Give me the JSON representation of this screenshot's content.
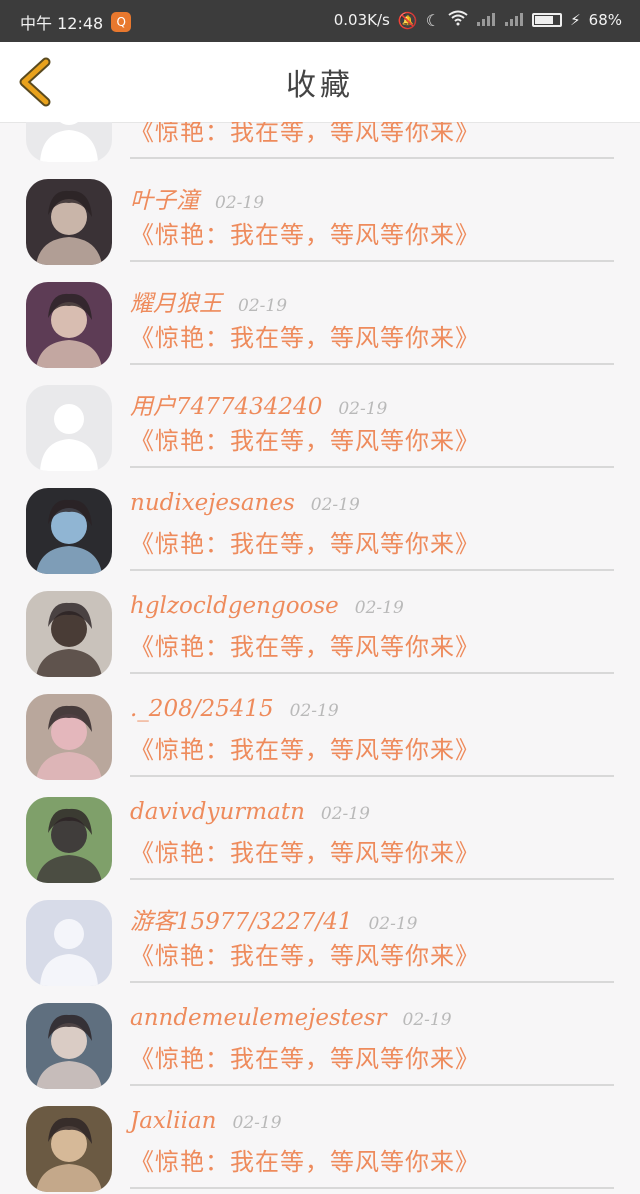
{
  "status_bar": {
    "time": "中午 12:48",
    "app_badge": "Q",
    "net_speed": "0.03K/s",
    "battery_percent": "68%",
    "battery_level": 0.68
  },
  "header": {
    "title": "收藏",
    "back_icon": "chevron-left-icon",
    "accent": "#e9a21c"
  },
  "colors": {
    "name": "#ee8b5c",
    "message": "#ee8b5c",
    "date": "#b9b9b9"
  },
  "items": [
    {
      "name": "",
      "date": "",
      "message": "《惊艳：我在等，等风等你来》",
      "avatar": "default"
    },
    {
      "name": "叶子潼",
      "date": "02-19",
      "message": "《惊艳：我在等，等风等你来》",
      "avatar": "photo-1"
    },
    {
      "name": "耀月狼王",
      "date": "02-19",
      "message": "《惊艳：我在等，等风等你来》",
      "avatar": "photo-2"
    },
    {
      "name": "用户7477434240",
      "date": "02-19",
      "message": "《惊艳：我在等，等风等你来》",
      "avatar": "default"
    },
    {
      "name": "nudixejesanes",
      "date": "02-19",
      "message": "《惊艳：我在等，等风等你来》",
      "avatar": "photo-3"
    },
    {
      "name": "hglzocldgengoose",
      "date": "02-19",
      "message": "《惊艳：我在等，等风等你来》",
      "avatar": "photo-4"
    },
    {
      "name": "._208/25415",
      "date": "02-19",
      "message": "《惊艳：我在等，等风等你来》",
      "avatar": "photo-5"
    },
    {
      "name": "davivdyurmatn",
      "date": "02-19",
      "message": "《惊艳：我在等，等风等你来》",
      "avatar": "photo-6"
    },
    {
      "name": "游客15977/3227/41",
      "date": "02-19",
      "message": "《惊艳：我在等，等风等你来》",
      "avatar": "default-blue"
    },
    {
      "name": "anndemeulemejestesr",
      "date": "02-19",
      "message": "《惊艳：我在等，等风等你来》",
      "avatar": "photo-7"
    },
    {
      "name": "Jaxliian",
      "date": "02-19",
      "message": "《惊艳：我在等，等风等你来》",
      "avatar": "photo-8"
    }
  ]
}
